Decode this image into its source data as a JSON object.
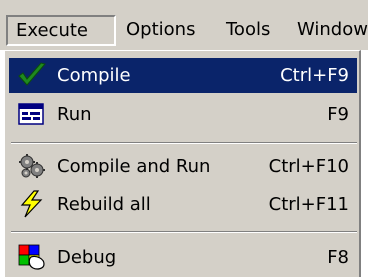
{
  "menubar": {
    "items": [
      {
        "label": "Execute"
      },
      {
        "label": "Options"
      },
      {
        "label": "Tools"
      },
      {
        "label": "Window"
      }
    ]
  },
  "menu": {
    "items": [
      {
        "label": "Compile",
        "shortcut": "Ctrl+F9",
        "icon": "checkmark-icon",
        "selected": true
      },
      {
        "label": "Run",
        "shortcut": "F9",
        "icon": "run-window-icon"
      },
      {
        "label": "Compile and Run",
        "shortcut": "Ctrl+F10",
        "icon": "gears-icon"
      },
      {
        "label": "Rebuild all",
        "shortcut": "Ctrl+F11",
        "icon": "lightning-icon"
      },
      {
        "label": "Debug",
        "shortcut": "F8",
        "icon": "debug-icon"
      }
    ]
  },
  "colors": {
    "menu_background": "#d4d0c8",
    "selection_background": "#0a246a",
    "selection_text": "#ffffff"
  }
}
